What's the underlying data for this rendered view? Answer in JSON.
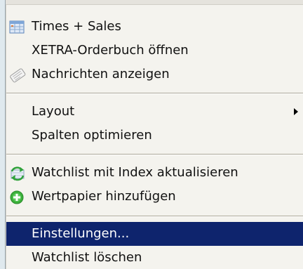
{
  "context_menu": {
    "items": [
      {
        "label": "Times + Sales",
        "icon": "table-icon"
      },
      {
        "label": "XETRA-Orderbuch öffnen",
        "icon": ""
      },
      {
        "label": "Nachrichten anzeigen",
        "icon": "news-icon"
      },
      {
        "label": "Layout",
        "icon": "",
        "has_submenu": true
      },
      {
        "label": "Spalten optimieren",
        "icon": ""
      },
      {
        "label": "Watchlist mit Index aktualisieren",
        "icon": "refresh-icon"
      },
      {
        "label": "Wertpapier hinzufügen",
        "icon": "add-icon"
      },
      {
        "label": "Einstellungen...",
        "icon": "",
        "selected": true
      },
      {
        "label": "Watchlist löschen",
        "icon": ""
      }
    ]
  },
  "colors": {
    "menu_background": "#f4f3ee",
    "selection": "#0e246d",
    "separator": "#aca899",
    "add_icon": "#3bb03b"
  }
}
